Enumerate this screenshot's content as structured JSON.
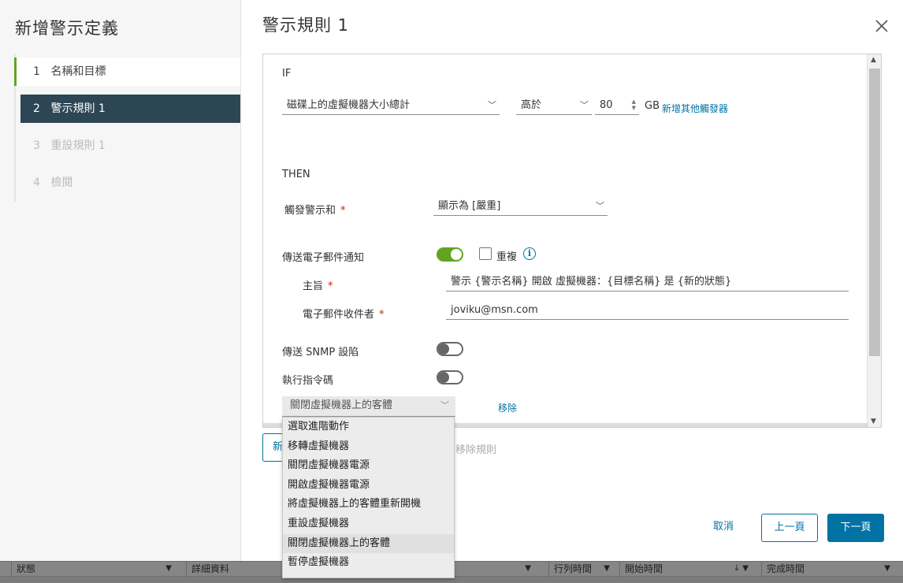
{
  "wizard": {
    "title": "新增警示定義",
    "steps": [
      {
        "num": "1",
        "label": "名稱和目標"
      },
      {
        "num": "2",
        "label": "警示規則 1"
      },
      {
        "num": "3",
        "label": "重設規則 1"
      },
      {
        "num": "4",
        "label": "檢閱"
      }
    ]
  },
  "main": {
    "title": "警示規則 1",
    "if_label": "IF",
    "trigger": {
      "metric": "磁碟上的虛擬機器大小總計",
      "operator": "高於",
      "value": "80",
      "unit": "GB",
      "add_trigger_link": "新增其他觸發器"
    },
    "then_label": "THEN",
    "trigger_alert": {
      "label": "觸發警示和",
      "value": "顯示為 [嚴重]"
    },
    "email": {
      "label": "傳送電子郵件通知",
      "enabled": true,
      "repeat_label": "重複",
      "subject_label": "主旨",
      "subject_value": "警示 {警示名稱} 開啟 虛擬機器：{目標名稱} 是 {新的狀態}",
      "recipients_label": "電子郵件收件者",
      "recipients_value": "joviku@msn.com"
    },
    "snmp": {
      "label": "傳送 SNMP 設陷",
      "enabled": false
    },
    "script": {
      "label": "執行指令碼",
      "enabled": false
    },
    "advanced_action": {
      "selected": "關閉虛擬機器上的客體",
      "remove_link": "移除",
      "options": [
        "選取進階動作",
        "移轉虛擬機器",
        "關閉虛擬機器電源",
        "開啟虛擬機器電源",
        "將虛擬機器上的客體重新開機",
        "重設虛擬機器",
        "關閉虛擬機器上的客體",
        "暫停虛擬機器"
      ]
    },
    "new_rule_btn": "新",
    "remove_rule": "移除規則"
  },
  "footer": {
    "cancel": "取消",
    "prev": "上一頁",
    "next": "下一頁"
  },
  "background_table": {
    "columns": [
      "狀態",
      "詳細資料",
      "",
      "行列時間",
      "開始時間",
      "完成時間"
    ]
  },
  "colors": {
    "accent": "#0072a3",
    "active_step": "#2c4656",
    "toggle_on": "#62a420",
    "required": "#c92100"
  }
}
